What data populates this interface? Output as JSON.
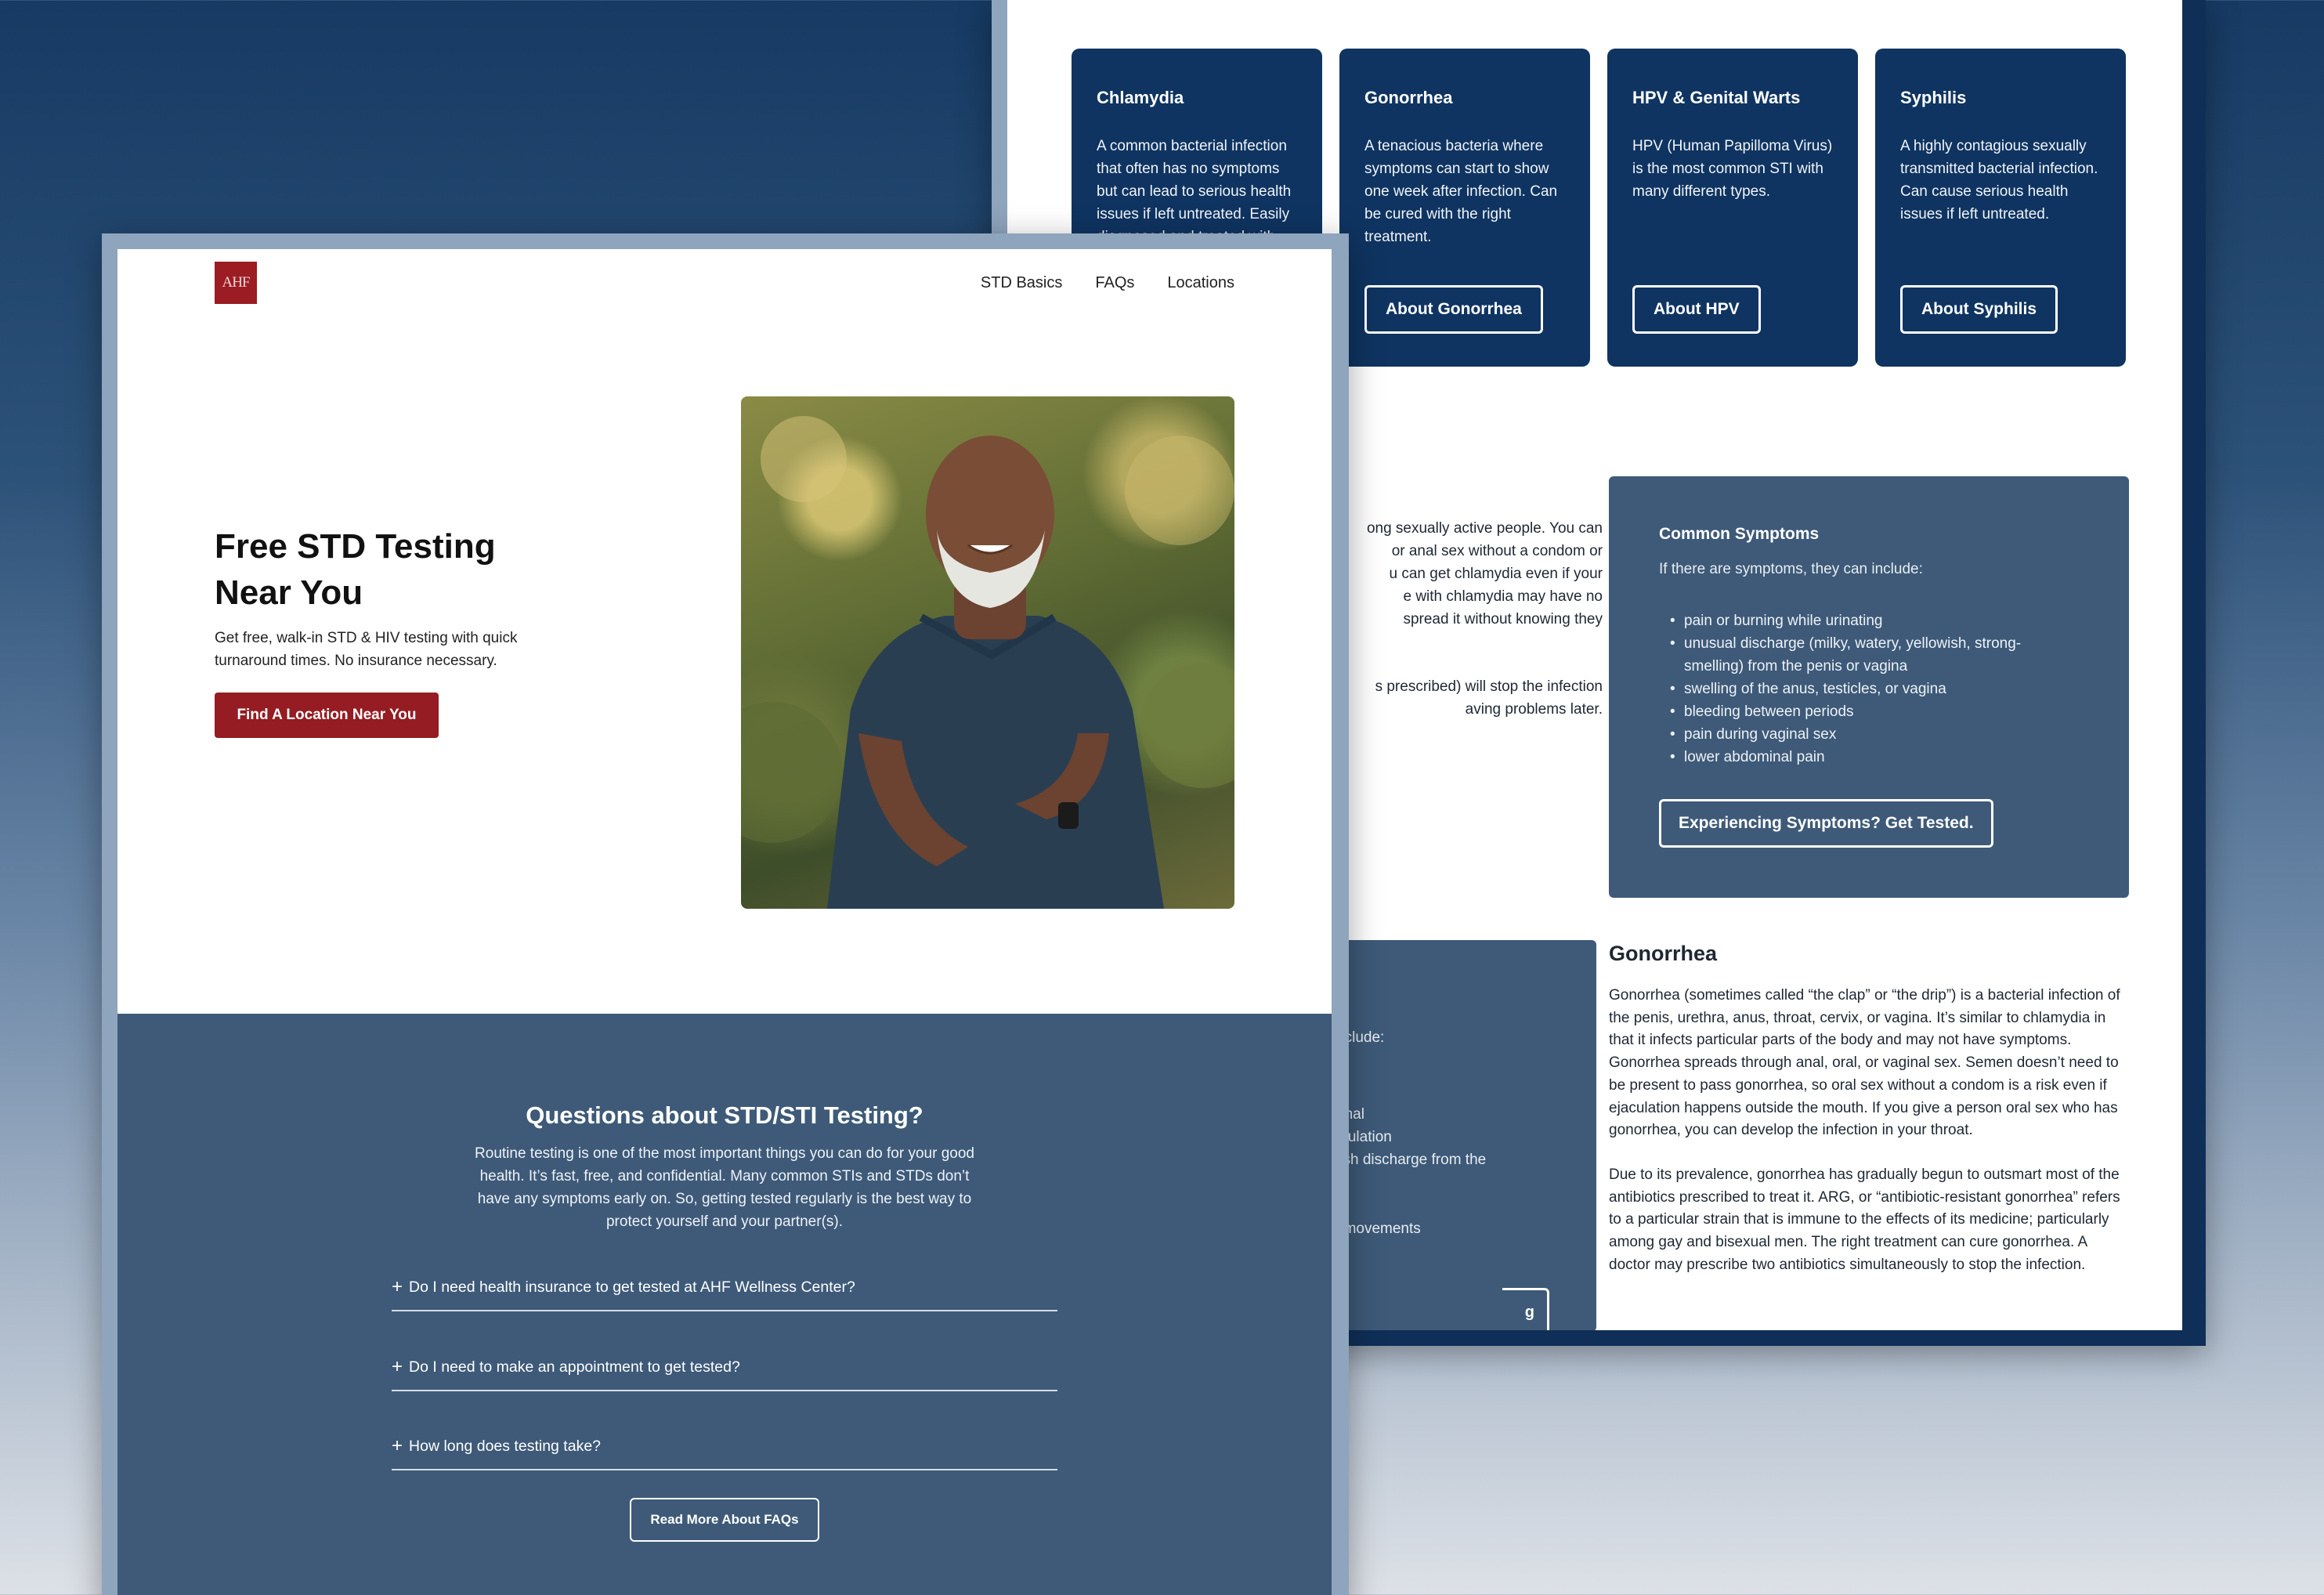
{
  "back_page": {
    "cards": [
      {
        "title": "Chlamydia",
        "text": "A common bacterial infection that often has no symptoms but can lead to serious health issues if left untreated. Easily diagnosed and treated with antibiotics.",
        "button": ""
      },
      {
        "title": "Gonorrhea",
        "text": "A tenacious bacteria where symptoms can start to show one week after infection. Can be cured with the right treatment.",
        "button": "About Gonorrhea"
      },
      {
        "title": "HPV & Genital Warts",
        "text": "HPV (Human Papilloma Virus) is the most common STI with many different types.",
        "button": "About HPV"
      },
      {
        "title": "Syphilis",
        "text": "A highly contagious sexually transmitted bacterial infection. Can cause serious health issues if left untreated.",
        "button": "About Syphilis"
      }
    ],
    "chlamydia_fragments": [
      "ong sexually active people. You can",
      "or anal sex without a condom or",
      "u can get chlamydia even if your",
      "e with chlamydia may have no",
      "spread it without knowing they"
    ],
    "chlamydia_fragments_2": [
      "s prescribed) will stop the infection",
      "aving problems later."
    ],
    "symptoms": {
      "title": "Common Symptoms",
      "intro": "If there are symptoms, they can include:",
      "items": [
        "pain or burning while urinating",
        "unusual discharge (milky, watery, yellowish, strong-smelling) from the penis or vagina",
        "swelling of the anus, testicles, or vagina",
        "bleeding between periods",
        "pain during vaginal sex",
        "lower abdominal pain"
      ],
      "button": "Experiencing Symptoms? Get Tested."
    },
    "gonorrhea_symptom_fragments": {
      "include": "n include:",
      "f1": "ominal",
      "f2": "ejaculation",
      "f3": "owish discharge from the",
      "f4": "vel movements",
      "btn": "g"
    },
    "gonorrhea": {
      "title": "Gonorrhea",
      "p1": "Gonorrhea (sometimes called “the clap” or “the drip”) is a bacterial infection of the penis, urethra, anus, throat, cervix, or vagina. It’s similar to chlamydia in that it infects particular parts of the body and may not have symptoms. Gonorrhea spreads through anal, oral, or vaginal sex. Semen doesn’t need to be present to pass gonorrhea, so oral sex without a condom is a risk even if ejaculation happens outside the mouth. If you give a person oral sex who has gonorrhea, you can develop the infection in your throat.",
      "p2": "Due to its prevalence, gonorrhea has gradually begun to outsmart most of the antibiotics prescribed to treat it. ARG, or “antibiotic-resistant gonorrhea” refers to a particular strain that is immune to the effects of its medicine; particularly among gay and bisexual men. The right treatment can cure gonorrhea. A doctor may prescribe two antibiotics simultaneously to stop the infection."
    }
  },
  "front_page": {
    "logo": "AHF",
    "nav": [
      "STD Basics",
      "FAQs",
      "Locations"
    ],
    "hero": {
      "title": "Free STD Testing Near You",
      "subtitle": "Get free, walk-in STD & HIV testing with quick turnaround times. No insurance necessary.",
      "button": "Find A Location Near You"
    },
    "faq": {
      "title": "Questions about STD/STI Testing?",
      "intro": "Routine testing is one of the most important things you can do for your good health. It’s fast, free, and confidential. Many common STIs and STDs don’t have any symptoms early on. So, getting tested regularly is the best way to protect yourself and your partner(s).",
      "items": [
        "Do I need health insurance to get tested at AHF Wellness Center?",
        "Do I need to make an appointment to get tested?",
        "How long does testing take?"
      ],
      "button": "Read More About FAQs"
    }
  },
  "colors": {
    "navy": "#0f3461",
    "slate": "#3e5a78",
    "brand_red": "#951c22"
  }
}
